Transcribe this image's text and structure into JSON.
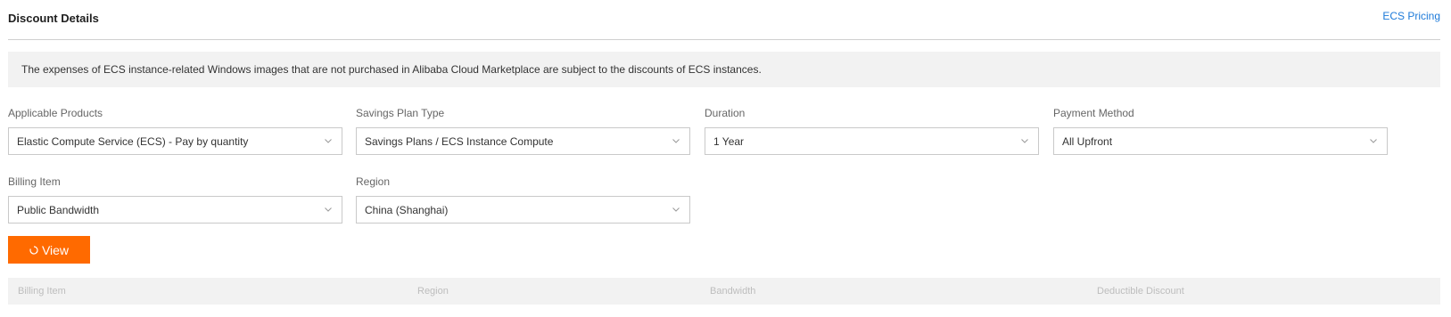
{
  "header": {
    "title": "Discount Details",
    "pricing_link": "ECS Pricing"
  },
  "notice": {
    "text": "The expenses of ECS instance-related Windows images that are not purchased in Alibaba Cloud Marketplace are subject to the discounts of ECS instances."
  },
  "filters": {
    "applicable_products": {
      "label": "Applicable Products",
      "value": "Elastic Compute Service (ECS) - Pay by quantity"
    },
    "savings_plan_type": {
      "label": "Savings Plan Type",
      "value": "Savings Plans / ECS Instance Compute"
    },
    "duration": {
      "label": "Duration",
      "value": "1 Year"
    },
    "payment_method": {
      "label": "Payment Method",
      "value": "All Upfront"
    },
    "billing_item": {
      "label": "Billing Item",
      "value": "Public Bandwidth"
    },
    "region": {
      "label": "Region",
      "value": "China (Shanghai)"
    }
  },
  "view_button": {
    "label": "View",
    "icon": "loading-spinner-icon"
  },
  "table": {
    "columns": [
      "Billing Item",
      "Region",
      "Bandwidth",
      "Deductible Discount"
    ]
  },
  "colors": {
    "accent": "#ff6a00",
    "link": "#1d7ad9",
    "notice_bg": "#f2f2f2",
    "border": "#c9c9c9"
  }
}
